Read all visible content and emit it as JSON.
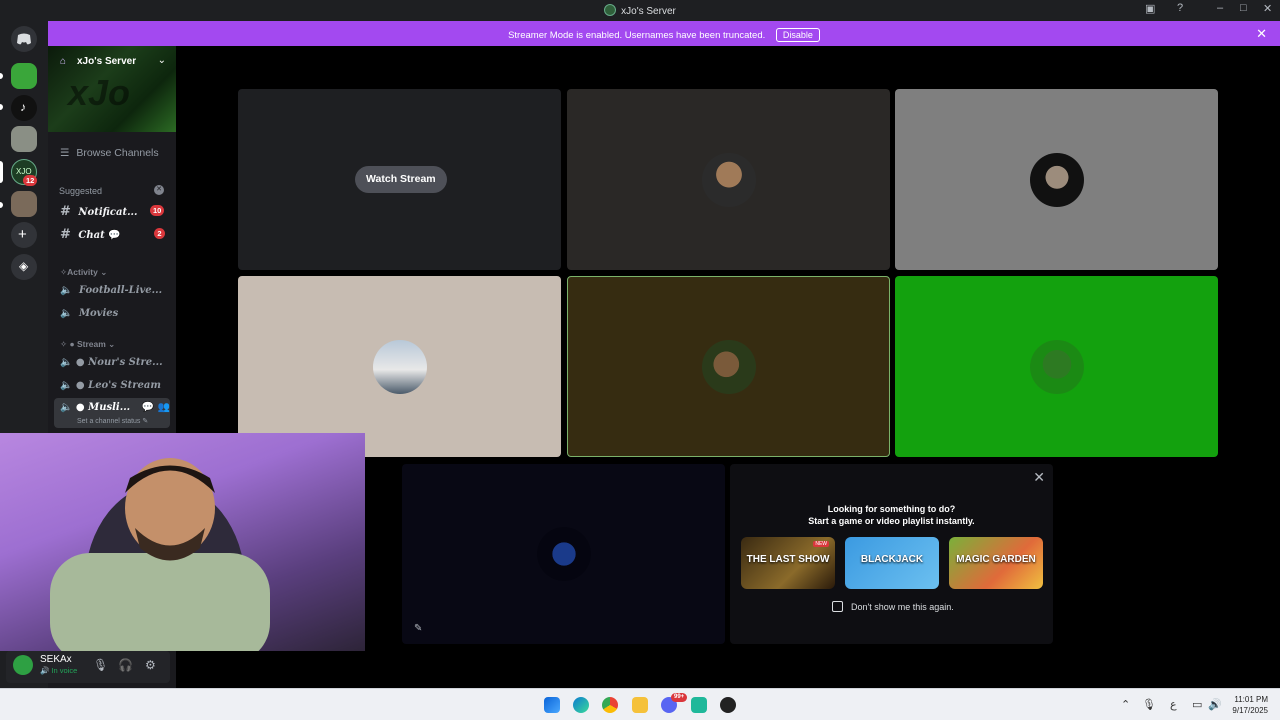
{
  "titlebar": {
    "title": "xJo's Server"
  },
  "banner": {
    "message": "Streamer Mode is enabled. Usernames have been truncated.",
    "disable_label": "Disable"
  },
  "server": {
    "name": "xJo's Server",
    "watermark": "xJo",
    "browse_label": "Browse Channels",
    "suggested_label": "Suggested",
    "channels": [
      {
        "name": "Notificat...",
        "badge": "10"
      },
      {
        "name": "Chat",
        "badge": "2"
      }
    ],
    "category_activity": "Activity",
    "activity_channels": [
      "Football-Live...",
      "Movies"
    ],
    "category_stream": "Stream",
    "stream_channels": [
      "Nour's Stre...",
      "Leo's Stream",
      "Musli..."
    ],
    "channel_status_hint": "Set a channel status"
  },
  "rail": {
    "dm_badge": "12"
  },
  "stage": {
    "watch_stream_label": "Watch Stream"
  },
  "promo": {
    "line1": "Looking for something to do?",
    "line2": "Start a game or video playlist instantly.",
    "games": [
      {
        "name": "THE LAST SHOW",
        "tag": "NEW"
      },
      {
        "name": "BLACKJACK",
        "tag": ""
      },
      {
        "name": "MAGIC GARDEN",
        "tag": ""
      }
    ],
    "dont_show_label": "Don't show me this again."
  },
  "user": {
    "name": "SEKAx",
    "status": "In voice"
  },
  "taskbar": {
    "time": "11:01 PM",
    "date": "9/17/2025",
    "discord_badge": "99+",
    "lang": "ع"
  },
  "colors": {
    "banner": "#a349f0",
    "green_tile": "#13a10e",
    "olive_tile": "#362c11",
    "sage_tile": "#c7bcb2"
  }
}
